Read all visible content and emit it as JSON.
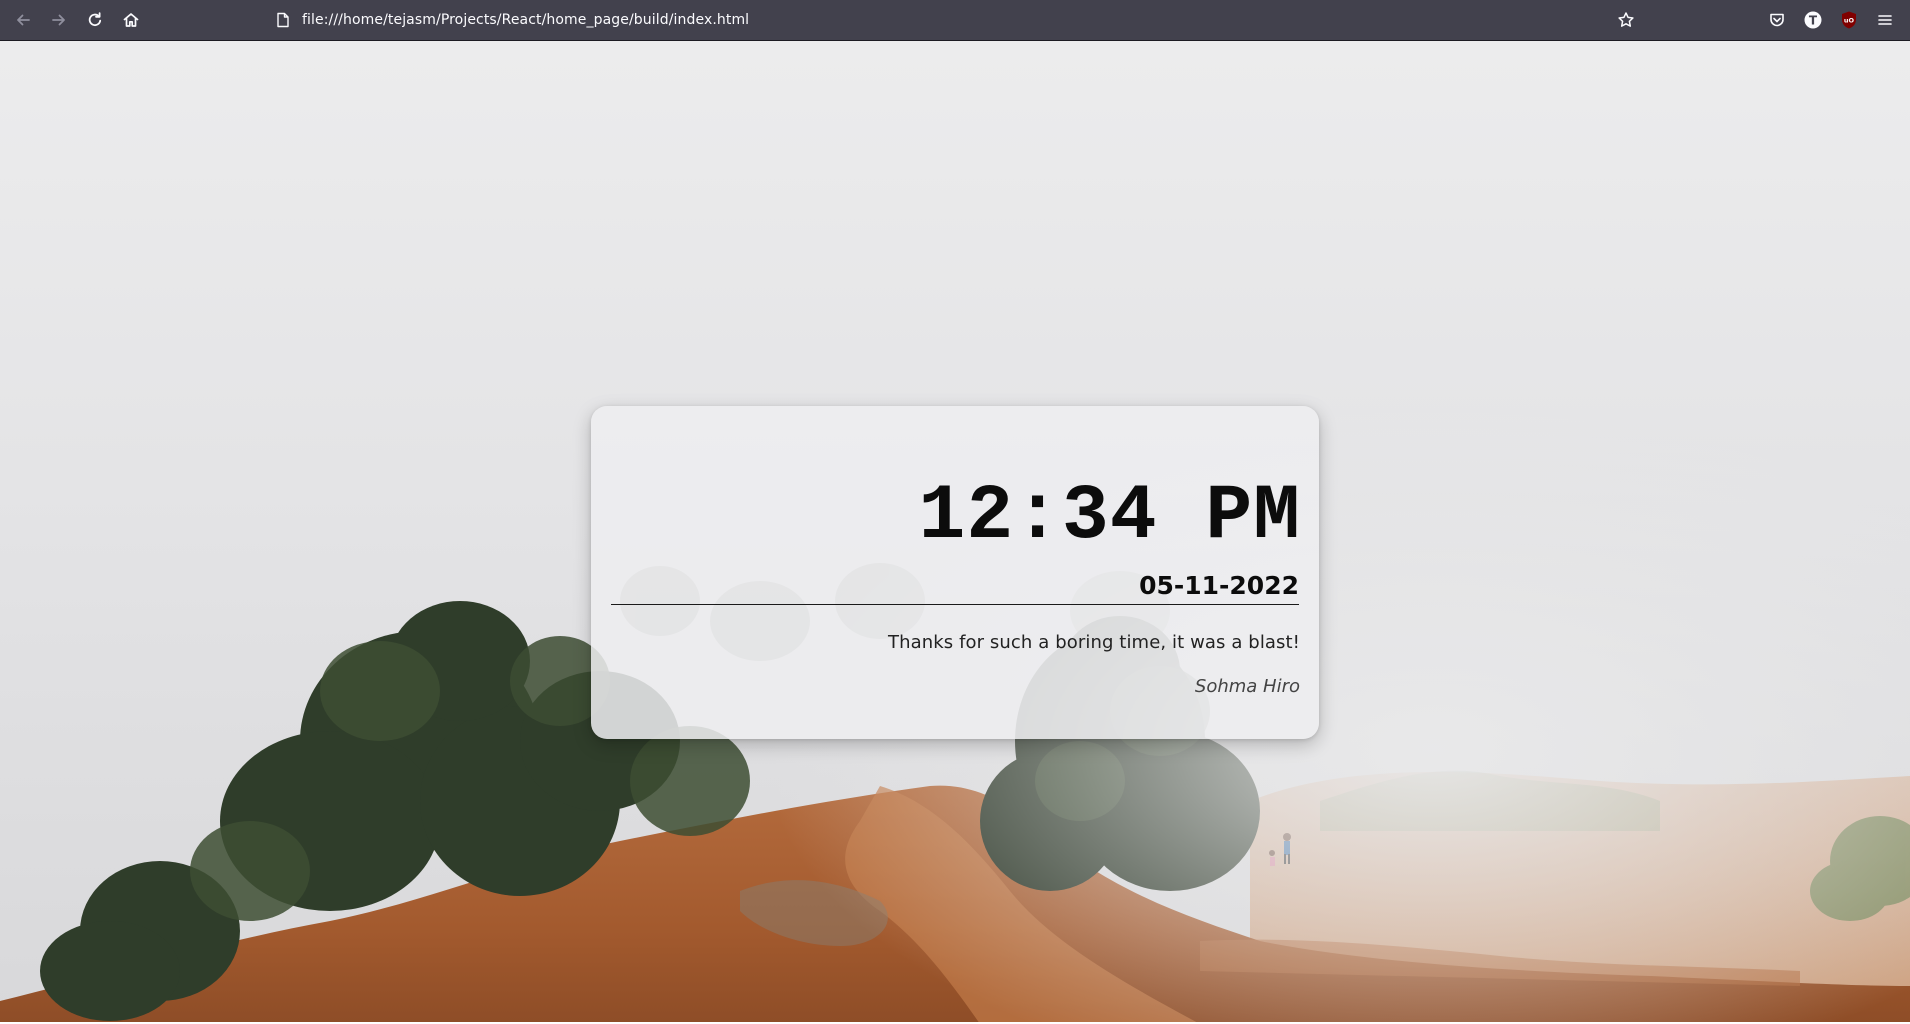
{
  "browser": {
    "url": "file:///home/tejasm/Projects/React/home_page/build/index.html",
    "icons": {
      "back": "arrow-left-icon",
      "forward": "arrow-right-icon",
      "reload": "reload-icon",
      "home": "home-icon",
      "page": "page-icon",
      "bookmark": "star-icon",
      "pocket": "pocket-icon",
      "extension_t": "extension-t-icon",
      "ublock": "ublock-origin-icon",
      "menu": "hamburger-menu-icon"
    },
    "extension_t_label": "T",
    "ublock_label": "uO"
  },
  "card": {
    "time": "12:34 PM",
    "date": "05-11-2022",
    "quote": "Thanks for such a boring time, it was a blast!",
    "author": "Sohma Hiro"
  },
  "colors": {
    "toolbar": "#42414d",
    "card_background": "#eeeef0",
    "text": "#0c0c0c"
  }
}
